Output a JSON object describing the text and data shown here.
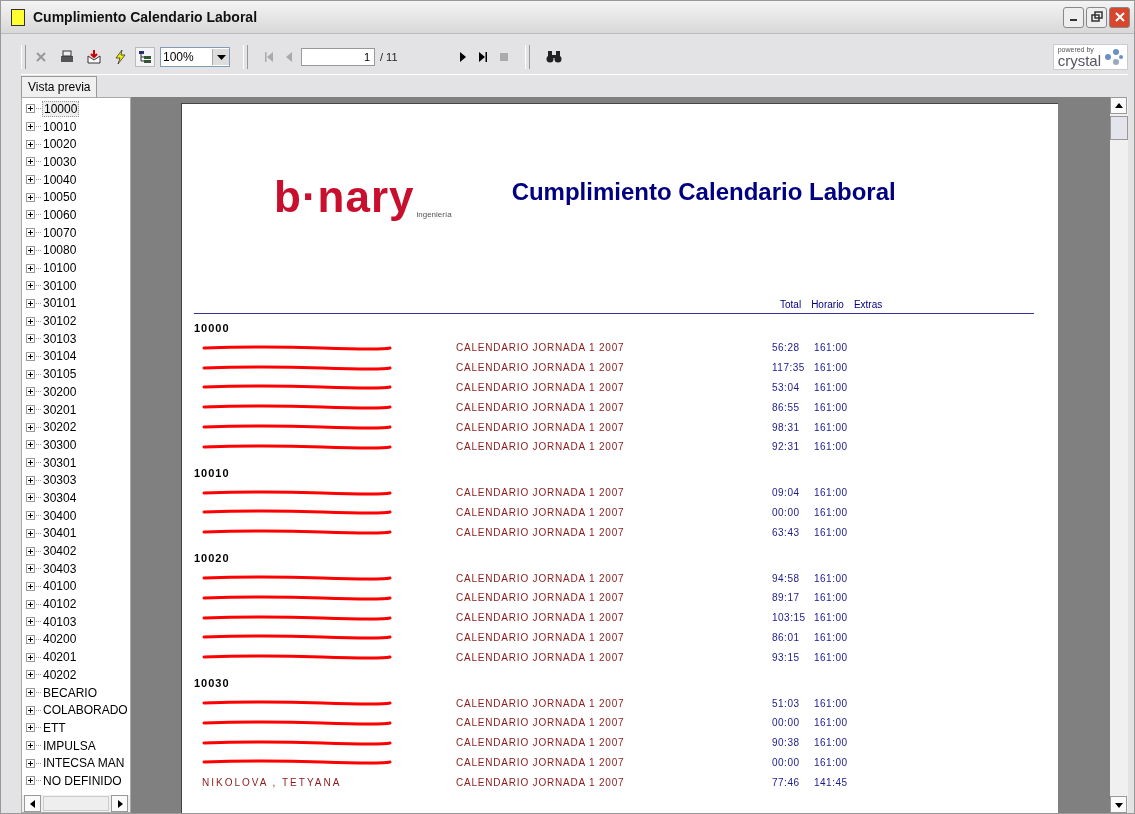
{
  "window": {
    "title": "Cumplimiento Calendario Laboral"
  },
  "toolbar": {
    "zoom": "100%",
    "page": "1",
    "page_total": "/ 11",
    "powered_by": "powered by",
    "brand": "crystal"
  },
  "tabs": [
    {
      "label": "Vista previa",
      "selected": true
    }
  ],
  "tree": [
    {
      "label": "10000",
      "selected": true
    },
    {
      "label": "10010",
      "selected": false
    },
    {
      "label": "10020",
      "selected": false
    },
    {
      "label": "10030",
      "selected": false
    },
    {
      "label": "10040",
      "selected": false
    },
    {
      "label": "10050",
      "selected": false
    },
    {
      "label": "10060",
      "selected": false
    },
    {
      "label": "10070",
      "selected": false
    },
    {
      "label": "10080",
      "selected": false
    },
    {
      "label": "10100",
      "selected": false
    },
    {
      "label": "30100",
      "selected": false
    },
    {
      "label": "30101",
      "selected": false
    },
    {
      "label": "30102",
      "selected": false
    },
    {
      "label": "30103",
      "selected": false
    },
    {
      "label": "30104",
      "selected": false
    },
    {
      "label": "30105",
      "selected": false
    },
    {
      "label": "30200",
      "selected": false
    },
    {
      "label": "30201",
      "selected": false
    },
    {
      "label": "30202",
      "selected": false
    },
    {
      "label": "30300",
      "selected": false
    },
    {
      "label": "30301",
      "selected": false
    },
    {
      "label": "30303",
      "selected": false
    },
    {
      "label": "30304",
      "selected": false
    },
    {
      "label": "30400",
      "selected": false
    },
    {
      "label": "30401",
      "selected": false
    },
    {
      "label": "30402",
      "selected": false
    },
    {
      "label": "30403",
      "selected": false
    },
    {
      "label": "40100",
      "selected": false
    },
    {
      "label": "40102",
      "selected": false
    },
    {
      "label": "40103",
      "selected": false
    },
    {
      "label": "40200",
      "selected": false
    },
    {
      "label": "40201",
      "selected": false
    },
    {
      "label": "40202",
      "selected": false
    },
    {
      "label": "BECARIO",
      "selected": false
    },
    {
      "label": "COLABORADO",
      "selected": false
    },
    {
      "label": "ETT",
      "selected": false
    },
    {
      "label": "IMPULSA",
      "selected": false
    },
    {
      "label": "INTECSA MAN",
      "selected": false
    },
    {
      "label": "NO DEFINIDO",
      "selected": false
    }
  ],
  "report": {
    "logo": "b·nary",
    "logo_sub": "ingeniería",
    "title": "Cumplimiento Calendario Laboral",
    "columns": [
      "Total",
      "Horario",
      "Extras"
    ],
    "groups": [
      {
        "code": "10000",
        "rows": [
          {
            "redacted": true,
            "calendar": "CALENDARIO JORNADA 1 2007",
            "total": "56:28",
            "horario": "161:00"
          },
          {
            "redacted": true,
            "calendar": "CALENDARIO JORNADA 1 2007",
            "total": "117:35",
            "horario": "161:00"
          },
          {
            "redacted": true,
            "calendar": "CALENDARIO JORNADA 1 2007",
            "total": "53:04",
            "horario": "161:00"
          },
          {
            "redacted": true,
            "calendar": "CALENDARIO JORNADA 1 2007",
            "total": "86:55",
            "horario": "161:00"
          },
          {
            "redacted": true,
            "calendar": "CALENDARIO JORNADA 1 2007",
            "total": "98:31",
            "horario": "161:00"
          },
          {
            "redacted": true,
            "calendar": "CALENDARIO JORNADA 1 2007",
            "total": "92:31",
            "horario": "161:00"
          }
        ]
      },
      {
        "code": "10010",
        "rows": [
          {
            "redacted": true,
            "calendar": "CALENDARIO JORNADA 1 2007",
            "total": "09:04",
            "horario": "161:00"
          },
          {
            "redacted": true,
            "calendar": "CALENDARIO JORNADA 1 2007",
            "total": "00:00",
            "horario": "161:00"
          },
          {
            "redacted": true,
            "calendar": "CALENDARIO JORNADA 1 2007",
            "total": "63:43",
            "horario": "161:00"
          }
        ]
      },
      {
        "code": "10020",
        "rows": [
          {
            "redacted": true,
            "calendar": "CALENDARIO JORNADA 1 2007",
            "total": "94:58",
            "horario": "161:00"
          },
          {
            "redacted": true,
            "calendar": "CALENDARIO JORNADA 1 2007",
            "total": "89:17",
            "horario": "161:00"
          },
          {
            "redacted": true,
            "calendar": "CALENDARIO JORNADA 1 2007",
            "total": "103:15",
            "horario": "161:00"
          },
          {
            "redacted": true,
            "calendar": "CALENDARIO JORNADA 1 2007",
            "total": "86:01",
            "horario": "161:00"
          },
          {
            "redacted": true,
            "calendar": "CALENDARIO JORNADA 1 2007",
            "total": "93:15",
            "horario": "161:00"
          }
        ]
      },
      {
        "code": "10030",
        "rows": [
          {
            "redacted": true,
            "calendar": "CALENDARIO JORNADA 1 2007",
            "total": "51:03",
            "horario": "161:00"
          },
          {
            "redacted": true,
            "calendar": "CALENDARIO JORNADA 1 2007",
            "total": "00:00",
            "horario": "161:00"
          },
          {
            "redacted": true,
            "calendar": "CALENDARIO JORNADA 1 2007",
            "total": "90:38",
            "horario": "161:00"
          },
          {
            "redacted": true,
            "calendar": "CALENDARIO JORNADA 1 2007",
            "total": "00:00",
            "horario": "161:00"
          },
          {
            "redacted": false,
            "name": "NIKOLOVA , TETYANA",
            "calendar": "CALENDARIO JORNADA 1 2007",
            "total": "77:46",
            "horario": "141:45"
          }
        ]
      }
    ]
  }
}
